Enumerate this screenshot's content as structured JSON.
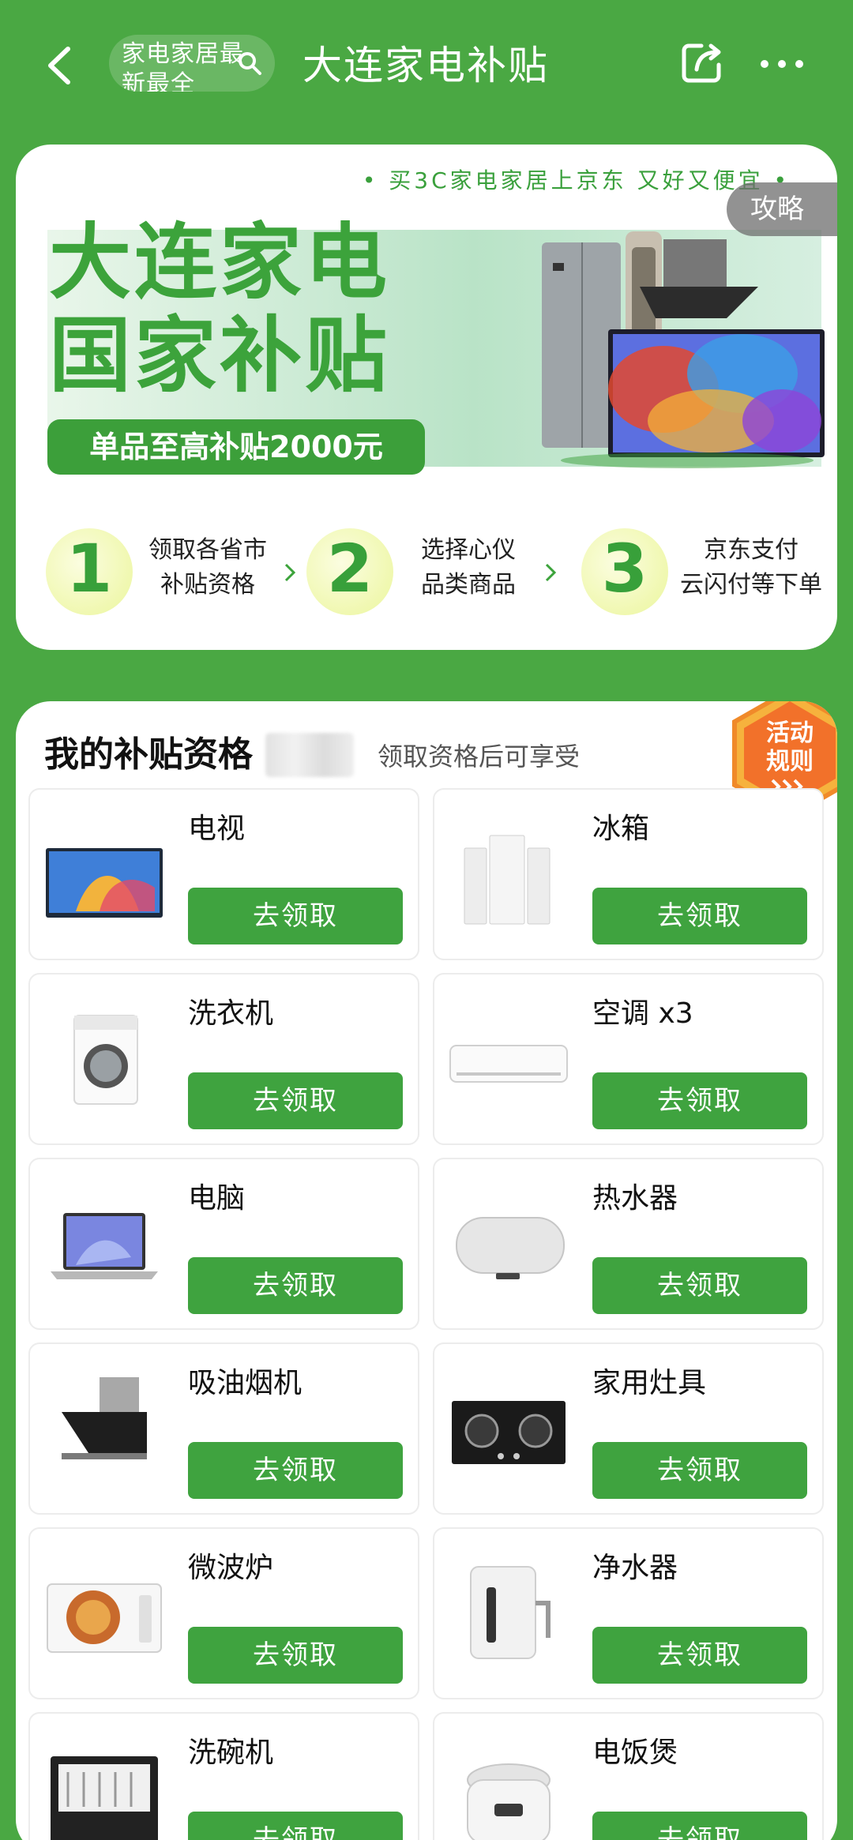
{
  "topbar": {
    "search_chip_text": "家电家居最新最全",
    "title": "大连家电补贴"
  },
  "banner": {
    "tagline": "• 买3C家电家居上京东 又好又便宜 •",
    "guide_label": "攻略",
    "hero_title_line1": "大连家电",
    "hero_title_line2": "国家补贴",
    "hero_badge": "单品至高补贴2000元",
    "steps": [
      {
        "num": "1",
        "line1": "领取各省市",
        "line2": "补贴资格"
      },
      {
        "num": "2",
        "line1": "选择心仪",
        "line2": "品类商品"
      },
      {
        "num": "3",
        "line1": "京东支付",
        "line2": "云闪付等下单"
      }
    ]
  },
  "eligibility": {
    "title": "我的补贴资格",
    "subtitle": "领取资格后可享受",
    "rules_line1": "活动",
    "rules_line2": "规则",
    "categories": [
      {
        "name": "电视",
        "button": "去领取"
      },
      {
        "name": "冰箱",
        "button": "去领取"
      },
      {
        "name": "洗衣机",
        "button": "去领取"
      },
      {
        "name": "空调 x3",
        "button": "去领取"
      },
      {
        "name": "电脑",
        "button": "去领取"
      },
      {
        "name": "热水器",
        "button": "去领取"
      },
      {
        "name": "吸油烟机",
        "button": "去领取"
      },
      {
        "name": "家用灶具",
        "button": "去领取"
      },
      {
        "name": "微波炉",
        "button": "去领取"
      },
      {
        "name": "净水器",
        "button": "去领取"
      },
      {
        "name": "洗碗机",
        "button": "去领取"
      },
      {
        "name": "电饭煲",
        "button": "去领取"
      }
    ]
  },
  "colors": {
    "brand_green": "#4aa843",
    "button_green": "#3fa33f",
    "accent_orange": "#f08a2a"
  }
}
